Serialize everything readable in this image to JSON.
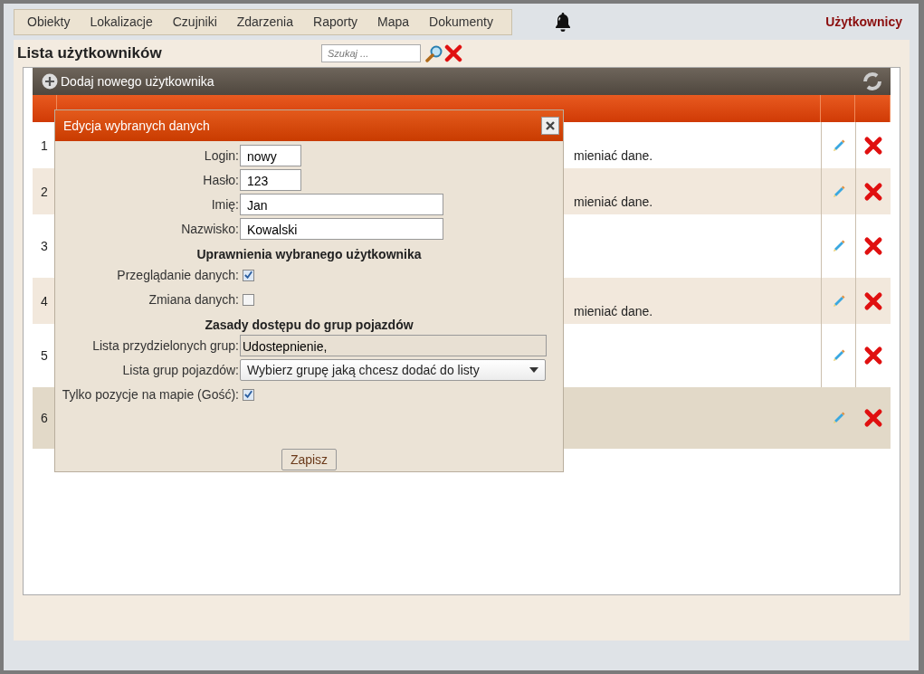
{
  "menu": [
    "Obiekty",
    "Lokalizacje",
    "Czujniki",
    "Zdarzenia",
    "Raporty",
    "Mapa",
    "Dokumenty"
  ],
  "user_link": "Użytkownicy",
  "page_title": "Lista użytkowników",
  "search": {
    "placeholder": "Szukaj ..."
  },
  "toolbar": {
    "add_label": "Dodaj nowego użytkownika"
  },
  "table": {
    "rows": [
      {
        "number": "1",
        "text": "mieniać dane.",
        "selected": false
      },
      {
        "number": "2",
        "text": "mieniać dane.",
        "selected": false
      },
      {
        "number": "3",
        "selected": false
      },
      {
        "number": "4",
        "text": "mieniać dane.",
        "selected": false
      },
      {
        "number": "5",
        "selected": false
      },
      {
        "number": "6",
        "selected": true
      }
    ]
  },
  "dialog": {
    "title": "Edycja wybranych danych",
    "items": [
      {
        "kind": "short_input",
        "label": "Login:",
        "value": "nowy"
      },
      {
        "kind": "short_input",
        "label": "Hasło:",
        "value": "123"
      },
      {
        "kind": "input",
        "label": "Imię:",
        "value": "Jan"
      },
      {
        "kind": "input",
        "label": "Nazwisko:",
        "value": "Kowalski"
      },
      {
        "kind": "heading",
        "label": "Uprawnienia wybranego użytkownika"
      },
      {
        "kind": "checkbox",
        "label": "Przeglądanie danych:",
        "checked": true
      },
      {
        "kind": "checkbox",
        "label": "Zmiana danych:",
        "checked": false
      },
      {
        "kind": "heading",
        "label": "Zasady dostępu do grup pojazdów"
      },
      {
        "kind": "readonly",
        "label": "Lista przydzielonych grup:",
        "value": "Udostepnienie,"
      },
      {
        "kind": "select",
        "label": "Lista grup pojazdów:",
        "value": "Wybierz grupę jaką chcesz dodać do listy"
      },
      {
        "kind": "checkbox",
        "label": "Tylko pozycje na mapie (Gość):",
        "checked": true
      }
    ],
    "save_button": "Zapisz"
  }
}
